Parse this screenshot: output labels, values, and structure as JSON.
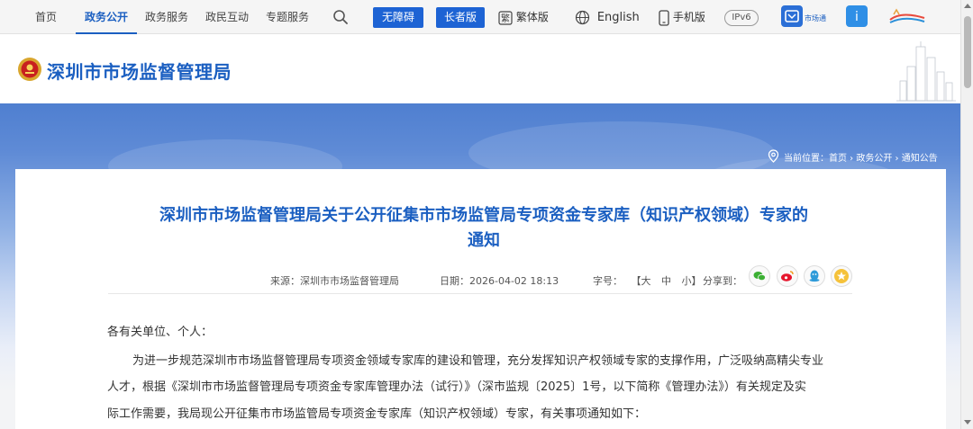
{
  "topnav": {
    "items": [
      {
        "label": "首页"
      },
      {
        "label": "政务公开"
      },
      {
        "label": "政务服务"
      },
      {
        "label": "政民互动"
      },
      {
        "label": "专题服务"
      }
    ],
    "accessibility_label": "无障碍",
    "elder_label": "长者版",
    "traditional_label": "繁体版",
    "english_label": "English",
    "mobile_label": "手机版",
    "ipv6_label": "IPv6",
    "app_labels": [
      "市场通"
    ]
  },
  "header": {
    "site_title": "深圳市市场监督管理局"
  },
  "breadcrumb": {
    "prefix": "当前位置：",
    "items": [
      "首页",
      "政务公开",
      "通知公告"
    ],
    "separator": " › "
  },
  "article": {
    "title_line1": "深圳市市场监督管理局关于公开征集市市场监管局专项资金专家库（知识产权领域）专家的",
    "title_line2": "通知",
    "source_label": "来源：",
    "source": "深圳市市场监督管理局",
    "date_label": "日期：",
    "date": "2026-04-02 18:13",
    "fontsize_label": "字号：",
    "fontsize_options": [
      "【大",
      "中",
      "小】"
    ],
    "share_label": "分享到：",
    "greeting": "各有关单位、个人：",
    "para1_line1": "为进一步规范深圳市市场监督管理局专项资金领域专家库的建设和管理，充分发挥知识产权领域专家的支撑作用，广泛吸纳高精尖专业",
    "para1_line2": "人才，根据《深圳市市场监督管理局专项资金专家库管理办法（试行）》（深市监规〔2025〕1号，以下简称《管理办法》）有关规定及实",
    "para1_line3": "际工作需要，我局现公开征集市市场监管局专项资金专家库（知识产权领域）专家，有关事项通知如下："
  },
  "colors": {
    "brand_blue": "#1b5fc1",
    "button_blue": "#1d63d4",
    "banner_top": "#4f7fd0",
    "page_bg": "#f3f4f6"
  },
  "icons": [
    "search-icon",
    "globe-icon",
    "phone-icon",
    "location-pin-icon",
    "wechat-icon",
    "weibo-icon",
    "qq-icon",
    "favorite-star-icon"
  ]
}
